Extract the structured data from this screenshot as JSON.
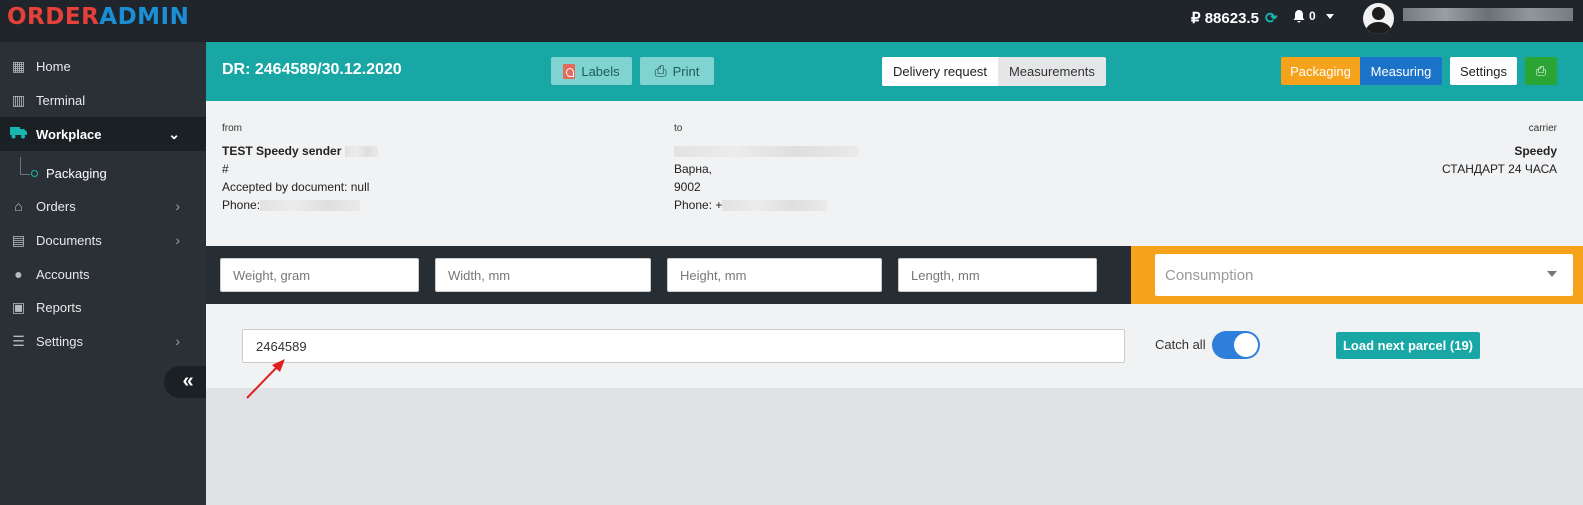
{
  "app": {
    "logo_part1": "ORDER",
    "logo_part2": "ADMIN",
    "balance": "₽ 88623.5",
    "notifications_count": "0"
  },
  "sidebar": {
    "items": [
      {
        "label": "Home",
        "icon": "grid-icon"
      },
      {
        "label": "Terminal",
        "icon": "barcode-icon"
      },
      {
        "label": "Workplace",
        "icon": "truck-icon",
        "active": true
      },
      {
        "label": "Orders",
        "icon": "warehouse-icon"
      },
      {
        "label": "Documents",
        "icon": "document-icon"
      },
      {
        "label": "Accounts",
        "icon": "user-icon"
      },
      {
        "label": "Reports",
        "icon": "report-icon"
      },
      {
        "label": "Settings",
        "icon": "sliders-icon"
      }
    ],
    "subitem": "Packaging"
  },
  "header": {
    "title": "DR: 2464589/30.12.2020",
    "labels_btn": "Labels",
    "print_btn": "Print",
    "seg_delivery": "Delivery request",
    "seg_measurements": "Measurements",
    "packaging_btn": "Packaging",
    "measuring_btn": "Measuring",
    "settings_btn": "Settings"
  },
  "info": {
    "from_label": "from",
    "from_name": "TEST Speedy sender",
    "from_hash": "#",
    "from_accepted": "Accepted by document: null",
    "from_phone": "Phone:",
    "to_label": "to",
    "to_city": "Варна,",
    "to_zip": "9002",
    "to_phone": "Phone: +",
    "carrier_label": "carrier",
    "carrier_name": "Speedy",
    "carrier_service": "СТАНДАРТ 24 ЧАСА"
  },
  "dims": {
    "weight_placeholder": "Weight, gram",
    "width_placeholder": "Width, mm",
    "height_placeholder": "Height, mm",
    "length_placeholder": "Length, mm",
    "consumption_placeholder": "Consumption"
  },
  "scan": {
    "value": "2464589",
    "catch_all_label": "Catch all",
    "catch_all_on": true,
    "load_next_btn": "Load next parcel (19)"
  },
  "colors": {
    "teal": "#19a7a5",
    "orange": "#f7a21b",
    "blue": "#1a73c9",
    "green": "#2aa534",
    "dark": "#1f252b"
  }
}
